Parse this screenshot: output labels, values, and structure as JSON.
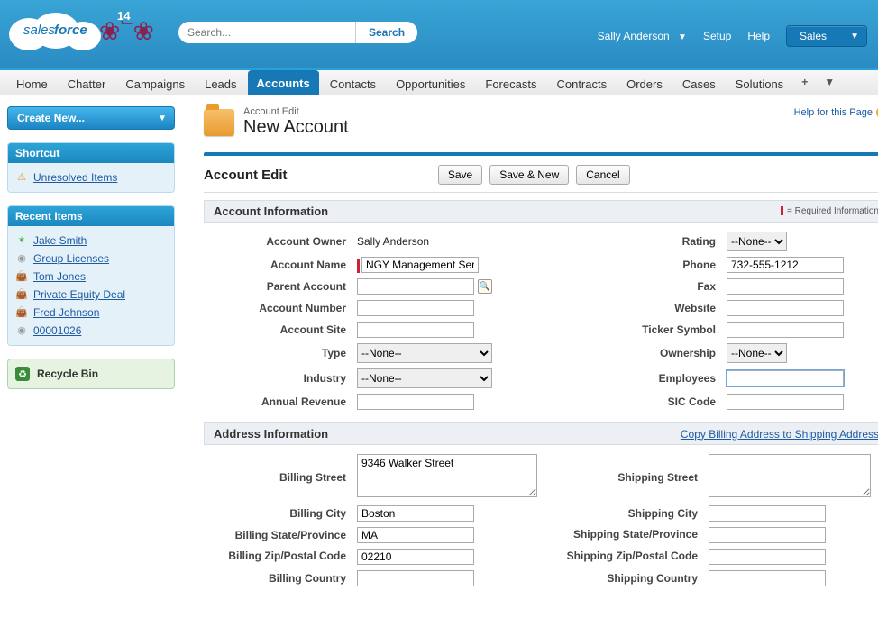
{
  "brand": {
    "logo_text": "salesforce",
    "badge": "14"
  },
  "header": {
    "search_placeholder": "Search...",
    "search_button": "Search",
    "user_name": "Sally Anderson",
    "setup": "Setup",
    "help": "Help",
    "app_name": "Sales"
  },
  "tabs": {
    "items": [
      "Home",
      "Chatter",
      "Campaigns",
      "Leads",
      "Accounts",
      "Contacts",
      "Opportunities",
      "Forecasts",
      "Contracts",
      "Orders",
      "Cases",
      "Solutions"
    ],
    "active_index": 4
  },
  "sidebar": {
    "create_label": "Create New...",
    "shortcut_title": "Shortcut",
    "unresolved": "Unresolved Items",
    "recent_title": "Recent Items",
    "recent": [
      {
        "icon": "person",
        "label": "Jake Smith"
      },
      {
        "icon": "disc",
        "label": "Group Licenses"
      },
      {
        "icon": "bag",
        "label": "Tom Jones"
      },
      {
        "icon": "bag",
        "label": "Private Equity Deal"
      },
      {
        "icon": "bag",
        "label": "Fred Johnson"
      },
      {
        "icon": "disc",
        "label": "00001026"
      }
    ],
    "recycle": "Recycle Bin"
  },
  "page": {
    "crumb": "Account Edit",
    "title": "New Account",
    "help": "Help for this Page"
  },
  "edit": {
    "heading": "Account Edit",
    "buttons": {
      "save": "Save",
      "save_new": "Save & New",
      "cancel": "Cancel"
    },
    "info_heading": "Account Information",
    "required_note": "= Required Information",
    "owner_label": "Account Owner",
    "owner_value": "Sally Anderson",
    "name_label": "Account Name",
    "name_value": "NGY Management Ser",
    "parent_label": "Parent Account",
    "parent_value": "",
    "number_label": "Account Number",
    "number_value": "",
    "site_label": "Account Site",
    "site_value": "",
    "type_label": "Type",
    "type_value": "--None--",
    "industry_label": "Industry",
    "industry_value": "--None--",
    "revenue_label": "Annual Revenue",
    "revenue_value": "",
    "rating_label": "Rating",
    "rating_value": "--None--",
    "phone_label": "Phone",
    "phone_value": "732-555-1212",
    "fax_label": "Fax",
    "fax_value": "",
    "website_label": "Website",
    "website_value": "",
    "ticker_label": "Ticker Symbol",
    "ticker_value": "",
    "ownership_label": "Ownership",
    "ownership_value": "--None--",
    "employees_label": "Employees",
    "employees_value": "",
    "sic_label": "SIC Code",
    "sic_value": ""
  },
  "address": {
    "heading": "Address Information",
    "copy_link": "Copy Billing Address to Shipping Address",
    "bill_street_label": "Billing Street",
    "bill_street_value": "9346 Walker Street",
    "bill_city_label": "Billing City",
    "bill_city_value": "Boston",
    "bill_state_label": "Billing State/Province",
    "bill_state_value": "MA",
    "bill_zip_label": "Billing Zip/Postal Code",
    "bill_zip_value": "02210",
    "bill_country_label": "Billing Country",
    "bill_country_value": "",
    "ship_street_label": "Shipping Street",
    "ship_street_value": "",
    "ship_city_label": "Shipping City",
    "ship_city_value": "",
    "ship_state_label": "Shipping State/Province",
    "ship_state_value": "",
    "ship_zip_label": "Shipping Zip/Postal Code",
    "ship_zip_value": "",
    "ship_country_label": "Shipping Country",
    "ship_country_value": ""
  }
}
